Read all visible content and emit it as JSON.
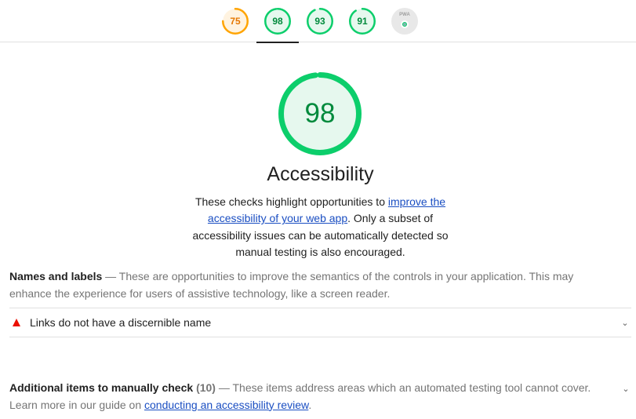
{
  "scores": [
    {
      "name": "performance",
      "value": "75",
      "fraction": 0.75,
      "color": "#ffa400",
      "track": "#fff3e0",
      "active": false
    },
    {
      "name": "accessibility",
      "value": "98",
      "fraction": 0.98,
      "color": "#0cce6b",
      "track": "#e6f8ee",
      "active": true
    },
    {
      "name": "best-practices",
      "value": "93",
      "fraction": 0.93,
      "color": "#0cce6b",
      "track": "#e6f8ee",
      "active": false
    },
    {
      "name": "seo",
      "value": "91",
      "fraction": 0.91,
      "color": "#0cce6b",
      "track": "#e6f8ee",
      "active": false
    }
  ],
  "pwa": {
    "label": "PWA",
    "icon": "pwa-badge-icon"
  },
  "category": {
    "score": "98",
    "fraction": 0.98,
    "color": "#0cce6b",
    "title": "Accessibility",
    "desc_1": "These checks highlight opportunities to ",
    "desc_link": "improve the accessibility of your web app",
    "desc_2": ". Only a subset of accessibility issues can be automatically detected so manual testing is also encouraged."
  },
  "groups": {
    "names": {
      "title": "Names and labels",
      "desc": " — These are opportunities to improve the semantics of the controls in your application. This may enhance the experience for users of assistive technology, like a screen reader."
    },
    "audit": {
      "title": "Links do not have a discernible name",
      "icon": "fail-triangle-icon"
    },
    "manual": {
      "title": "Additional items to manually check",
      "count": "(10)",
      "desc": " — These items address areas which an automated testing tool cannot cover. Learn more in our guide on ",
      "link": "conducting an accessibility review",
      "end": "."
    }
  }
}
